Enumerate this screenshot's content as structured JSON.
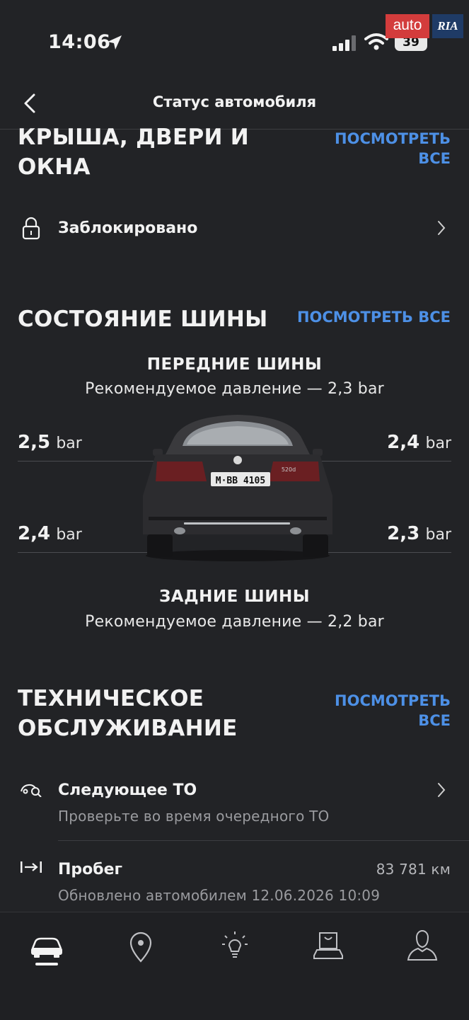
{
  "status_bar": {
    "time": "14:06",
    "battery": "39"
  },
  "watermark": {
    "left": "auto",
    "right": "RIA"
  },
  "header": {
    "title": "Статус автомобиля"
  },
  "roof_section": {
    "title_line1": "КРЫША, ДВЕРИ И",
    "title_line2": "ОКНА",
    "view_all_line1": "ПОСМОТРЕТЬ",
    "view_all_line2": "ВСЕ",
    "lock_label": "Заблокировано"
  },
  "tires_section": {
    "title": "СОСТОЯНИЕ ШИНЫ",
    "view_all": "ПОСМОТРЕТЬ ВСЕ",
    "front_heading": "ПЕРЕДНИЕ ШИНЫ",
    "front_recommended": "Рекомендуемое давление — 2,3 bar",
    "rear_heading": "ЗАДНИЕ ШИНЫ",
    "rear_recommended": "Рекомендуемое давление — 2,2 bar",
    "unit": "bar",
    "front_left": "2,5",
    "front_right": "2,4",
    "rear_left": "2,4",
    "rear_right": "2,3",
    "plate": "M·BB 4105",
    "badge": "520d"
  },
  "service_section": {
    "title_line1": "ТЕХНИЧЕСКОЕ",
    "title_line2": "ОБСЛУЖИВАНИЕ",
    "view_all_line1": "ПОСМОТРЕТЬ",
    "view_all_line2": "ВСЕ",
    "next_service_label": "Следующее ТО",
    "next_service_sub": "Проверьте во время очередного ТО",
    "mileage_label": "Пробег",
    "mileage_value": "83 781 км",
    "mileage_sub": "Обновлено автомобилем 12.06.2026 10:09"
  },
  "tabbar": {
    "tabs": [
      "car-icon",
      "location-pin-icon",
      "lightbulb-icon",
      "shop-icon",
      "profile-icon"
    ]
  },
  "colors": {
    "accent": "#4d90e6",
    "background": "#222326"
  }
}
